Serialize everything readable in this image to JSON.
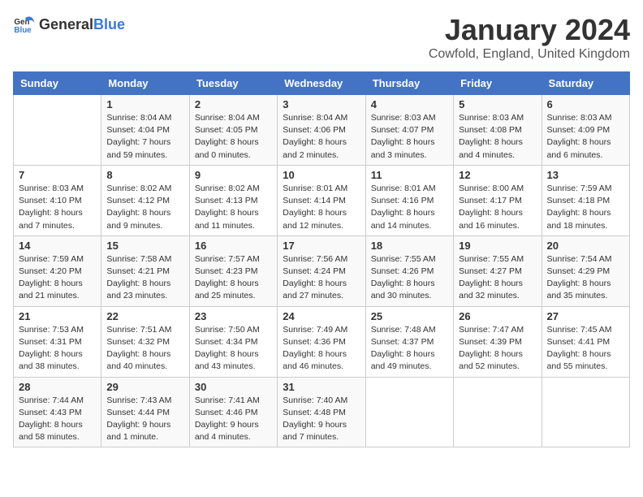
{
  "logo": {
    "general": "General",
    "blue": "Blue"
  },
  "title": "January 2024",
  "location": "Cowfold, England, United Kingdom",
  "days_of_week": [
    "Sunday",
    "Monday",
    "Tuesday",
    "Wednesday",
    "Thursday",
    "Friday",
    "Saturday"
  ],
  "weeks": [
    [
      {
        "day": "",
        "info": ""
      },
      {
        "day": "1",
        "info": "Sunrise: 8:04 AM\nSunset: 4:04 PM\nDaylight: 7 hours\nand 59 minutes."
      },
      {
        "day": "2",
        "info": "Sunrise: 8:04 AM\nSunset: 4:05 PM\nDaylight: 8 hours\nand 0 minutes."
      },
      {
        "day": "3",
        "info": "Sunrise: 8:04 AM\nSunset: 4:06 PM\nDaylight: 8 hours\nand 2 minutes."
      },
      {
        "day": "4",
        "info": "Sunrise: 8:03 AM\nSunset: 4:07 PM\nDaylight: 8 hours\nand 3 minutes."
      },
      {
        "day": "5",
        "info": "Sunrise: 8:03 AM\nSunset: 4:08 PM\nDaylight: 8 hours\nand 4 minutes."
      },
      {
        "day": "6",
        "info": "Sunrise: 8:03 AM\nSunset: 4:09 PM\nDaylight: 8 hours\nand 6 minutes."
      }
    ],
    [
      {
        "day": "7",
        "info": "Sunrise: 8:03 AM\nSunset: 4:10 PM\nDaylight: 8 hours\nand 7 minutes."
      },
      {
        "day": "8",
        "info": "Sunrise: 8:02 AM\nSunset: 4:12 PM\nDaylight: 8 hours\nand 9 minutes."
      },
      {
        "day": "9",
        "info": "Sunrise: 8:02 AM\nSunset: 4:13 PM\nDaylight: 8 hours\nand 11 minutes."
      },
      {
        "day": "10",
        "info": "Sunrise: 8:01 AM\nSunset: 4:14 PM\nDaylight: 8 hours\nand 12 minutes."
      },
      {
        "day": "11",
        "info": "Sunrise: 8:01 AM\nSunset: 4:16 PM\nDaylight: 8 hours\nand 14 minutes."
      },
      {
        "day": "12",
        "info": "Sunrise: 8:00 AM\nSunset: 4:17 PM\nDaylight: 8 hours\nand 16 minutes."
      },
      {
        "day": "13",
        "info": "Sunrise: 7:59 AM\nSunset: 4:18 PM\nDaylight: 8 hours\nand 18 minutes."
      }
    ],
    [
      {
        "day": "14",
        "info": "Sunrise: 7:59 AM\nSunset: 4:20 PM\nDaylight: 8 hours\nand 21 minutes."
      },
      {
        "day": "15",
        "info": "Sunrise: 7:58 AM\nSunset: 4:21 PM\nDaylight: 8 hours\nand 23 minutes."
      },
      {
        "day": "16",
        "info": "Sunrise: 7:57 AM\nSunset: 4:23 PM\nDaylight: 8 hours\nand 25 minutes."
      },
      {
        "day": "17",
        "info": "Sunrise: 7:56 AM\nSunset: 4:24 PM\nDaylight: 8 hours\nand 27 minutes."
      },
      {
        "day": "18",
        "info": "Sunrise: 7:55 AM\nSunset: 4:26 PM\nDaylight: 8 hours\nand 30 minutes."
      },
      {
        "day": "19",
        "info": "Sunrise: 7:55 AM\nSunset: 4:27 PM\nDaylight: 8 hours\nand 32 minutes."
      },
      {
        "day": "20",
        "info": "Sunrise: 7:54 AM\nSunset: 4:29 PM\nDaylight: 8 hours\nand 35 minutes."
      }
    ],
    [
      {
        "day": "21",
        "info": "Sunrise: 7:53 AM\nSunset: 4:31 PM\nDaylight: 8 hours\nand 38 minutes."
      },
      {
        "day": "22",
        "info": "Sunrise: 7:51 AM\nSunset: 4:32 PM\nDaylight: 8 hours\nand 40 minutes."
      },
      {
        "day": "23",
        "info": "Sunrise: 7:50 AM\nSunset: 4:34 PM\nDaylight: 8 hours\nand 43 minutes."
      },
      {
        "day": "24",
        "info": "Sunrise: 7:49 AM\nSunset: 4:36 PM\nDaylight: 8 hours\nand 46 minutes."
      },
      {
        "day": "25",
        "info": "Sunrise: 7:48 AM\nSunset: 4:37 PM\nDaylight: 8 hours\nand 49 minutes."
      },
      {
        "day": "26",
        "info": "Sunrise: 7:47 AM\nSunset: 4:39 PM\nDaylight: 8 hours\nand 52 minutes."
      },
      {
        "day": "27",
        "info": "Sunrise: 7:45 AM\nSunset: 4:41 PM\nDaylight: 8 hours\nand 55 minutes."
      }
    ],
    [
      {
        "day": "28",
        "info": "Sunrise: 7:44 AM\nSunset: 4:43 PM\nDaylight: 8 hours\nand 58 minutes."
      },
      {
        "day": "29",
        "info": "Sunrise: 7:43 AM\nSunset: 4:44 PM\nDaylight: 9 hours\nand 1 minute."
      },
      {
        "day": "30",
        "info": "Sunrise: 7:41 AM\nSunset: 4:46 PM\nDaylight: 9 hours\nand 4 minutes."
      },
      {
        "day": "31",
        "info": "Sunrise: 7:40 AM\nSunset: 4:48 PM\nDaylight: 9 hours\nand 7 minutes."
      },
      {
        "day": "",
        "info": ""
      },
      {
        "day": "",
        "info": ""
      },
      {
        "day": "",
        "info": ""
      }
    ]
  ]
}
